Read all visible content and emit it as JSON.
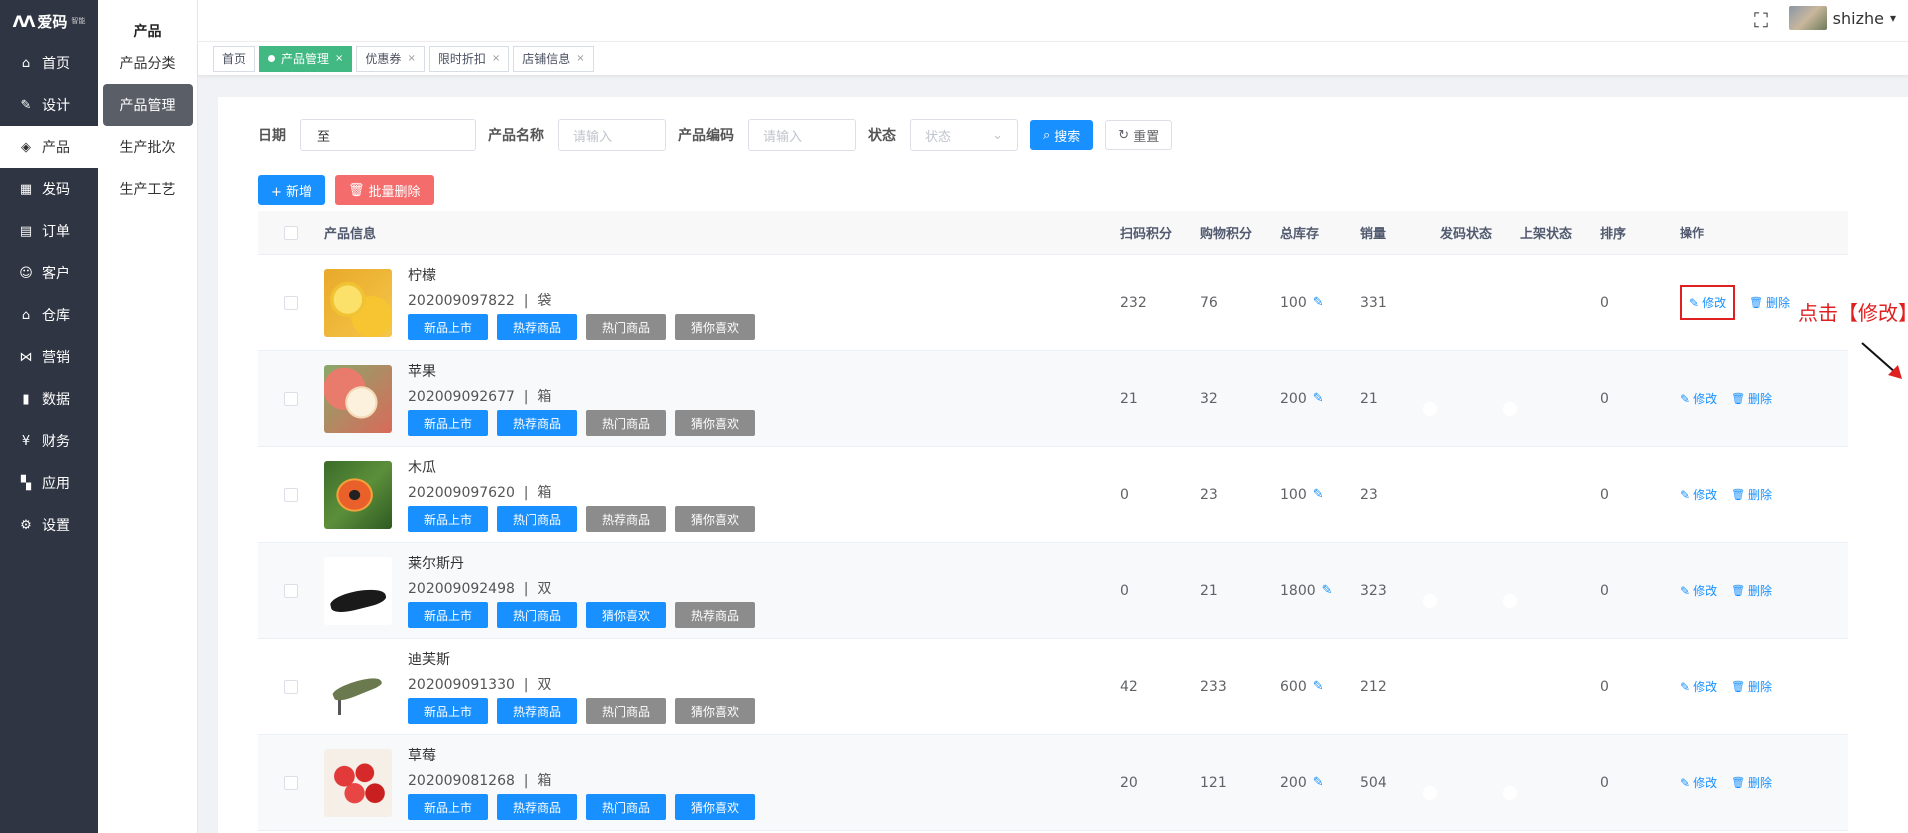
{
  "brand": {
    "name": "爱码",
    "sub": "智能"
  },
  "nav": [
    {
      "label": "首页",
      "icon": "home-icon",
      "glyph": "⌂"
    },
    {
      "label": "设计",
      "icon": "design-tools-icon",
      "glyph": "✎"
    },
    {
      "label": "产品",
      "icon": "cube-icon",
      "glyph": "◈"
    },
    {
      "label": "发码",
      "icon": "qrcode-icon",
      "glyph": "▦"
    },
    {
      "label": "订单",
      "icon": "order-icon",
      "glyph": "▤"
    },
    {
      "label": "客户",
      "icon": "users-icon",
      "glyph": "☺"
    },
    {
      "label": "仓库",
      "icon": "warehouse-icon",
      "glyph": "⌂"
    },
    {
      "label": "营销",
      "icon": "share-icon",
      "glyph": "⋈"
    },
    {
      "label": "数据",
      "icon": "bar-chart-icon",
      "glyph": "▮"
    },
    {
      "label": "财务",
      "icon": "yen-icon",
      "glyph": "¥"
    },
    {
      "label": "应用",
      "icon": "apps-grid-icon",
      "glyph": "▚"
    },
    {
      "label": "设置",
      "icon": "gear-icon",
      "glyph": "⚙"
    }
  ],
  "submenu": {
    "title": "产品",
    "items": [
      "产品分类",
      "产品管理",
      "生产批次",
      "生产工艺"
    ]
  },
  "topbar": {
    "username": "shizhe",
    "fullscreen_glyph": "⛶",
    "caret": "▾"
  },
  "tabs": [
    {
      "label": "首页"
    },
    {
      "label": "产品管理"
    },
    {
      "label": "优惠券"
    },
    {
      "label": "限时折扣"
    },
    {
      "label": "店铺信息"
    }
  ],
  "filters": {
    "date_label": "日期",
    "date_sep": "至",
    "name_label": "产品名称",
    "name_placeholder": "请输入",
    "code_label": "产品编码",
    "code_placeholder": "请输入",
    "status_label": "状态",
    "status_placeholder": "状态",
    "search": "搜索",
    "reset": "重置"
  },
  "actions": {
    "add": "+ 新增",
    "batch_delete": "批量删除"
  },
  "columns": {
    "info": "产品信息",
    "scan": "扫码积分",
    "shop": "购物积分",
    "stock": "总库存",
    "sales": "销量",
    "code_status": "发码状态",
    "shelf_status": "上架状态",
    "sort": "排序",
    "ops": "操作"
  },
  "op_labels": {
    "edit": "修改",
    "delete": "删除"
  },
  "annotation": "点击【修改】",
  "rows": [
    {
      "name": "柠檬",
      "code": "202009097822",
      "unit": "袋",
      "tags": [
        [
          "新品上市",
          "blue"
        ],
        [
          "热荐商品",
          "blue"
        ],
        [
          "热门商品",
          "gray"
        ],
        [
          "猜你喜欢",
          "gray"
        ]
      ],
      "scan": "232",
      "shop": "76",
      "stock": "100",
      "sales": "331",
      "sort": "0",
      "img": "img-lemon"
    },
    {
      "name": "苹果",
      "code": "202009092677",
      "unit": "箱",
      "tags": [
        [
          "新品上市",
          "blue"
        ],
        [
          "热荐商品",
          "blue"
        ],
        [
          "热门商品",
          "gray"
        ],
        [
          "猜你喜欢",
          "gray"
        ]
      ],
      "scan": "21",
      "shop": "32",
      "stock": "200",
      "sales": "21",
      "sort": "0",
      "img": "img-apple"
    },
    {
      "name": "木瓜",
      "code": "202009097620",
      "unit": "箱",
      "tags": [
        [
          "新品上市",
          "blue"
        ],
        [
          "热门商品",
          "blue"
        ],
        [
          "热荐商品",
          "gray"
        ],
        [
          "猜你喜欢",
          "gray"
        ]
      ],
      "scan": "0",
      "shop": "23",
      "stock": "100",
      "sales": "23",
      "sort": "0",
      "img": "img-papaya"
    },
    {
      "name": "莱尔斯丹",
      "code": "202009092498",
      "unit": "双",
      "tags": [
        [
          "新品上市",
          "blue"
        ],
        [
          "热门商品",
          "blue"
        ],
        [
          "猜你喜欢",
          "blue"
        ],
        [
          "热荐商品",
          "gray"
        ]
      ],
      "scan": "0",
      "shop": "21",
      "stock": "1800",
      "sales": "323",
      "sort": "0",
      "img": "img-shoe1"
    },
    {
      "name": "迪芙斯",
      "code": "202009091330",
      "unit": "双",
      "tags": [
        [
          "新品上市",
          "blue"
        ],
        [
          "热荐商品",
          "blue"
        ],
        [
          "热门商品",
          "gray"
        ],
        [
          "猜你喜欢",
          "gray"
        ]
      ],
      "scan": "42",
      "shop": "233",
      "stock": "600",
      "sales": "212",
      "sort": "0",
      "img": "img-shoe2"
    },
    {
      "name": "草莓",
      "code": "202009081268",
      "unit": "箱",
      "tags": [
        [
          "新品上市",
          "blue"
        ],
        [
          "热荐商品",
          "blue"
        ],
        [
          "热门商品",
          "blue"
        ],
        [
          "猜你喜欢",
          "blue"
        ]
      ],
      "scan": "20",
      "shop": "121",
      "stock": "200",
      "sales": "504",
      "sort": "0",
      "img": "img-straw"
    }
  ],
  "colors": {
    "accent": "#1890ff",
    "danger": "#f56c6c",
    "tab_active": "#42b983",
    "nav_bg": "#2f3542",
    "annotation": "#e02020"
  }
}
